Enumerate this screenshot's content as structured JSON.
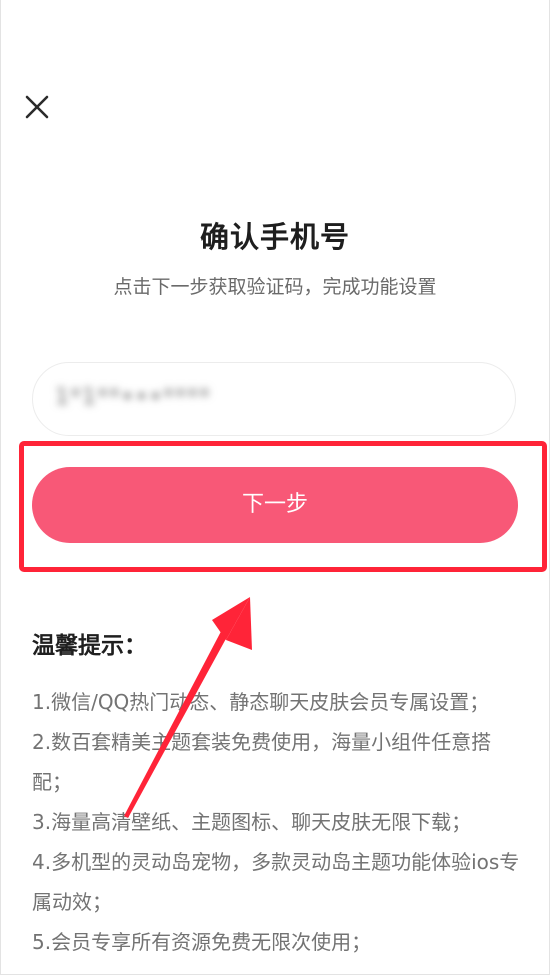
{
  "header": {
    "close_icon": "close-icon"
  },
  "title": "确认手机号",
  "subtitle": "点击下一步获取验证码，完成功能设置",
  "phone_field": {
    "value": "1*1**•••****"
  },
  "next_button": {
    "label": "下一步"
  },
  "tips": {
    "heading": "温馨提示：",
    "items": [
      "1.微信/QQ热门动态、静态聊天皮肤会员专属设置；",
      "2.数百套精美主题套装免费使用，海量小组件任意搭配；",
      "3.海量高清壁纸、主题图标、聊天皮肤无限下载；",
      "4.多机型的灵动岛宠物，多款灵动岛主题功能体验ios专属动效；",
      "5.会员专享所有资源免费无限次使用；"
    ]
  },
  "colors": {
    "button_bg": "#f85877",
    "highlight_border": "#ff2438",
    "arrow": "#ff2438"
  }
}
